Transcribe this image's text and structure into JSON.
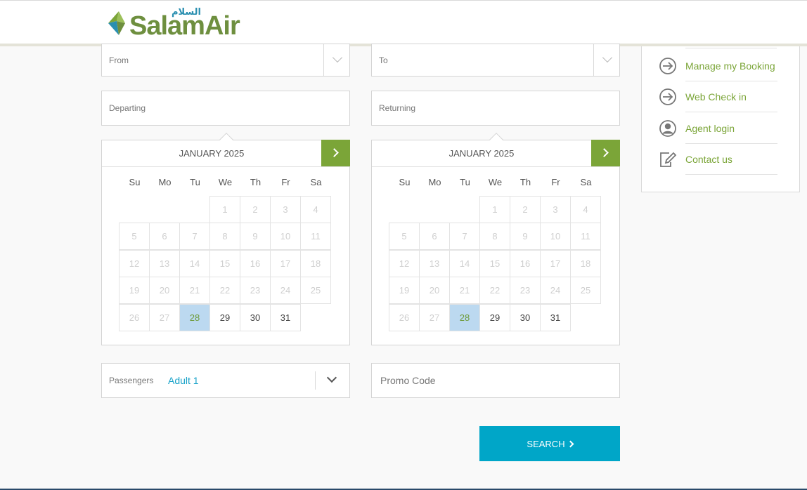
{
  "brand": {
    "name": "Salam",
    "name_accent": "Air",
    "arabic": "السلام"
  },
  "form": {
    "from_label": "From",
    "to_label": "To",
    "departing_label": "Departing",
    "returning_label": "Returning",
    "passengers_label": "Passengers",
    "passengers_value": "Adult 1",
    "promo_placeholder": "Promo Code",
    "search_label": "SEARCH"
  },
  "calendars": [
    {
      "month": "JANUARY 2025",
      "weekdays": [
        "Su",
        "Mo",
        "Tu",
        "We",
        "Th",
        "Fr",
        "Sa"
      ],
      "days": [
        "1",
        "2",
        "3",
        "4",
        "5",
        "6",
        "7",
        "8",
        "9",
        "10",
        "11",
        "12",
        "13",
        "14",
        "15",
        "16",
        "17",
        "18",
        "19",
        "20",
        "21",
        "22",
        "23",
        "24",
        "25",
        "26",
        "27",
        "28",
        "29",
        "30",
        "31"
      ],
      "first_weekday_index": 3,
      "selected_day": 28,
      "first_available_day": 28
    },
    {
      "month": "JANUARY 2025",
      "weekdays": [
        "Su",
        "Mo",
        "Tu",
        "We",
        "Th",
        "Fr",
        "Sa"
      ],
      "days": [
        "1",
        "2",
        "3",
        "4",
        "5",
        "6",
        "7",
        "8",
        "9",
        "10",
        "11",
        "12",
        "13",
        "14",
        "15",
        "16",
        "17",
        "18",
        "19",
        "20",
        "21",
        "22",
        "23",
        "24",
        "25",
        "26",
        "27",
        "28",
        "29",
        "30",
        "31"
      ],
      "first_weekday_index": 3,
      "selected_day": 28,
      "first_available_day": 28
    }
  ],
  "sidebar": {
    "items": [
      {
        "label": "Manage my Booking",
        "icon": "arrow-circle-icon"
      },
      {
        "label": "Web Check in",
        "icon": "arrow-circle-icon"
      },
      {
        "label": "Agent login",
        "icon": "user-circle-icon"
      },
      {
        "label": "Contact us",
        "icon": "edit-note-icon"
      }
    ]
  },
  "colors": {
    "brand_green": "#7ba538",
    "accent_blue": "#00a6c8",
    "selected_day": "#bcd9f0"
  }
}
